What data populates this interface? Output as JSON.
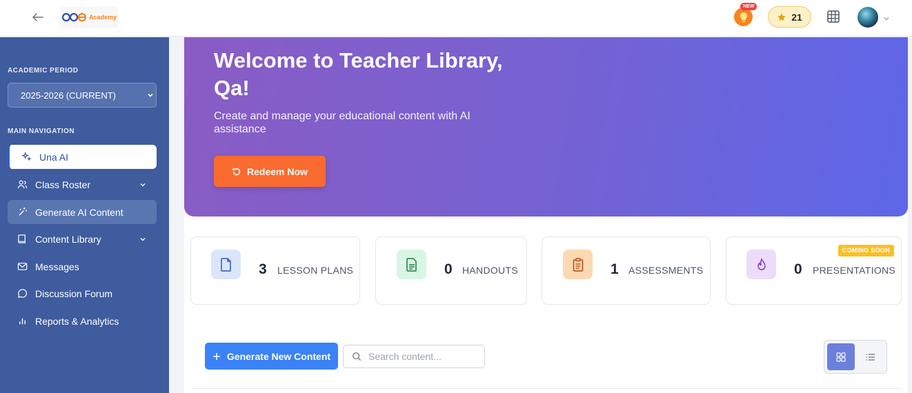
{
  "header": {
    "logo_text": "Academy",
    "new_badge": "NEW",
    "points": "21",
    "icons": {
      "back": "arrow-left-icon",
      "bulb": "lightbulb-icon",
      "star": "star-icon",
      "apps": "grid-apps-icon",
      "avatar_chevron": "chevron-down-icon"
    }
  },
  "sidebar": {
    "academic_period_label": "ACADEMIC PERIOD",
    "academic_period_value": "2025-2026 (CURRENT)",
    "main_nav_label": "MAIN NAVIGATION",
    "items": [
      {
        "label": "Una AI",
        "icon": "sparkles-icon",
        "state": "active"
      },
      {
        "label": "Class Roster",
        "icon": "users-icon",
        "has_chevron": true
      },
      {
        "label": "Generate AI Content",
        "icon": "magic-wand-icon",
        "state": "highlight"
      },
      {
        "label": "Content Library",
        "icon": "book-icon",
        "has_chevron": true
      },
      {
        "label": "Messages",
        "icon": "mail-icon"
      },
      {
        "label": "Discussion Forum",
        "icon": "chat-bubble-icon"
      },
      {
        "label": "Reports & Analytics",
        "icon": "bar-chart-icon"
      }
    ]
  },
  "hero": {
    "title": "Welcome to Teacher Library, Qa!",
    "subtitle": "Create and manage your educational content with AI assistance",
    "redeem_label": "Redeem Now"
  },
  "stats": [
    {
      "count": "3",
      "label": "LESSON PLANS",
      "icon": "document-icon",
      "color": "#dbe6fb"
    },
    {
      "count": "0",
      "label": "HANDOUTS",
      "icon": "document-text-icon",
      "color": "#d9f5e4"
    },
    {
      "count": "1",
      "label": "ASSESSMENTS",
      "icon": "clipboard-icon",
      "color": "#fcd9b0"
    },
    {
      "count": "0",
      "label": "PRESENTATIONS",
      "icon": "flame-icon",
      "color": "#ecdcfa",
      "badge": "COMING SOON"
    }
  ],
  "toolbar": {
    "generate_label": "Generate New Content",
    "search_placeholder": "Search content...",
    "view_mode": "grid"
  },
  "colors": {
    "accent": "#3b82f6",
    "sidebar": "#3e5c9e",
    "redeem": "#fa6b2f"
  }
}
